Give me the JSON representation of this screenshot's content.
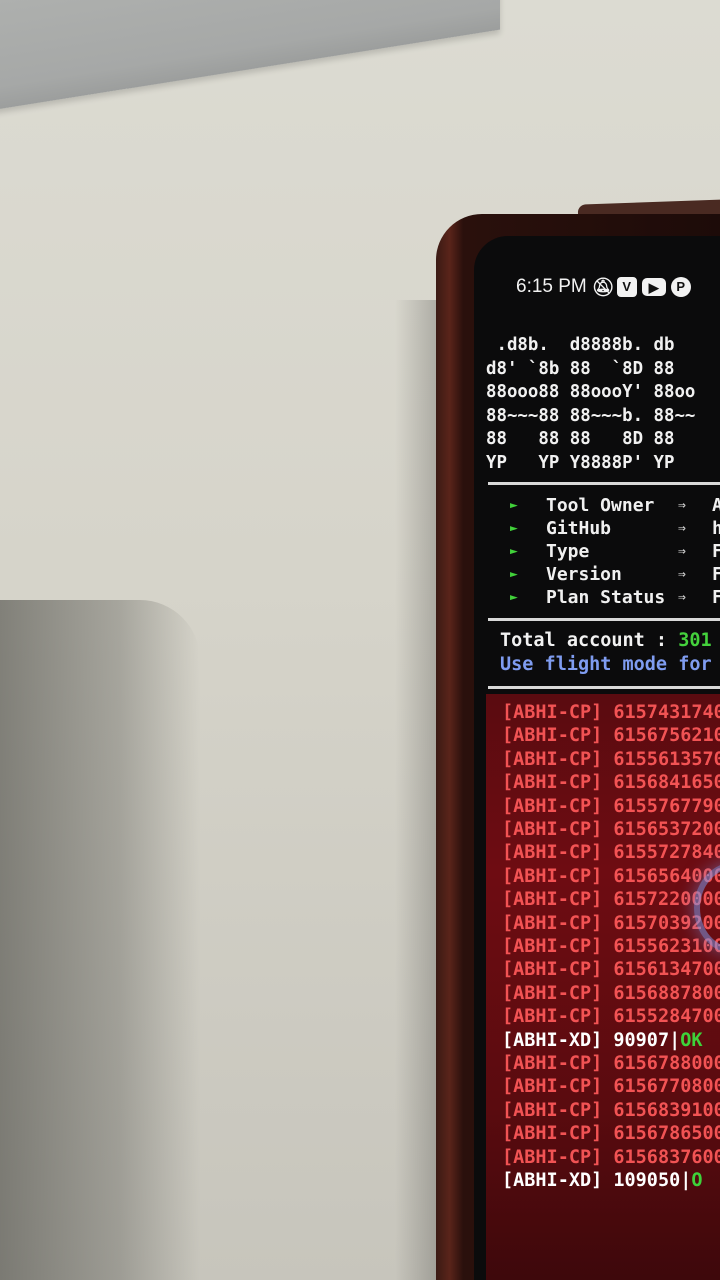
{
  "status_bar": {
    "time": "6:15 PM",
    "icons": [
      "bell-muted-icon",
      "v-app-icon",
      "youtube-icon",
      "pinterest-icon"
    ]
  },
  "banner_lines": [
    " .d8b.  d8888b. db",
    "d8' `8b 88  `8D 88",
    "88ooo88 88oooY' 88oo",
    "88~~~88 88~~~b. 88~~",
    "88   88 88   8D 88",
    "YP   YP Y8888P' YP"
  ],
  "info": [
    {
      "label": "Tool Owner",
      "value": "A"
    },
    {
      "label": "GitHub",
      "value": "h"
    },
    {
      "label": "Type",
      "value": "F"
    },
    {
      "label": "Version",
      "value": "F"
    },
    {
      "label": "Plan Status",
      "value": "F"
    }
  ],
  "summary": {
    "total_label": "Total account : ",
    "total_value": "301",
    "flight_text": "Use flight mode for"
  },
  "log": [
    {
      "tag": "[ABHI-CP]",
      "id": "6157431740",
      "kind": "cp"
    },
    {
      "tag": "[ABHI-CP]",
      "id": "6156756210",
      "kind": "cp"
    },
    {
      "tag": "[ABHI-CP]",
      "id": "6155613570",
      "kind": "cp"
    },
    {
      "tag": "[ABHI-CP]",
      "id": "6156841650",
      "kind": "cp"
    },
    {
      "tag": "[ABHI-CP]",
      "id": "6155767790",
      "kind": "cp"
    },
    {
      "tag": "[ABHI-CP]",
      "id": "6156537200",
      "kind": "cp"
    },
    {
      "tag": "[ABHI-CP]",
      "id": "6155727840",
      "kind": "cp"
    },
    {
      "tag": "[ABHI-CP]",
      "id": "6156564000",
      "kind": "cp"
    },
    {
      "tag": "[ABHI-CP]",
      "id": "6157220000",
      "kind": "cp"
    },
    {
      "tag": "[ABHI-CP]",
      "id": "6157039200",
      "kind": "cp"
    },
    {
      "tag": "[ABHI-CP]",
      "id": "6155623100",
      "kind": "cp"
    },
    {
      "tag": "[ABHI-CP]",
      "id": "6156134700",
      "kind": "cp"
    },
    {
      "tag": "[ABHI-CP]",
      "id": "6156887800",
      "kind": "cp"
    },
    {
      "tag": "[ABHI-CP]",
      "id": "6155284700",
      "kind": "cp"
    },
    {
      "tag": "[ABHI-XD]",
      "id": "90907",
      "ok": "OK",
      "kind": "xd"
    },
    {
      "tag": "[ABHI-CP]",
      "id": "6156788000",
      "kind": "cp"
    },
    {
      "tag": "[ABHI-CP]",
      "id": "6156770800",
      "kind": "cp"
    },
    {
      "tag": "[ABHI-CP]",
      "id": "6156839100",
      "kind": "cp"
    },
    {
      "tag": "[ABHI-CP]",
      "id": "6156786500",
      "kind": "cp"
    },
    {
      "tag": "[ABHI-CP]",
      "id": "6156837600",
      "kind": "cp"
    },
    {
      "tag": "[ABHI-XD]",
      "id": "109050",
      "ok": "O",
      "kind": "xd"
    }
  ]
}
